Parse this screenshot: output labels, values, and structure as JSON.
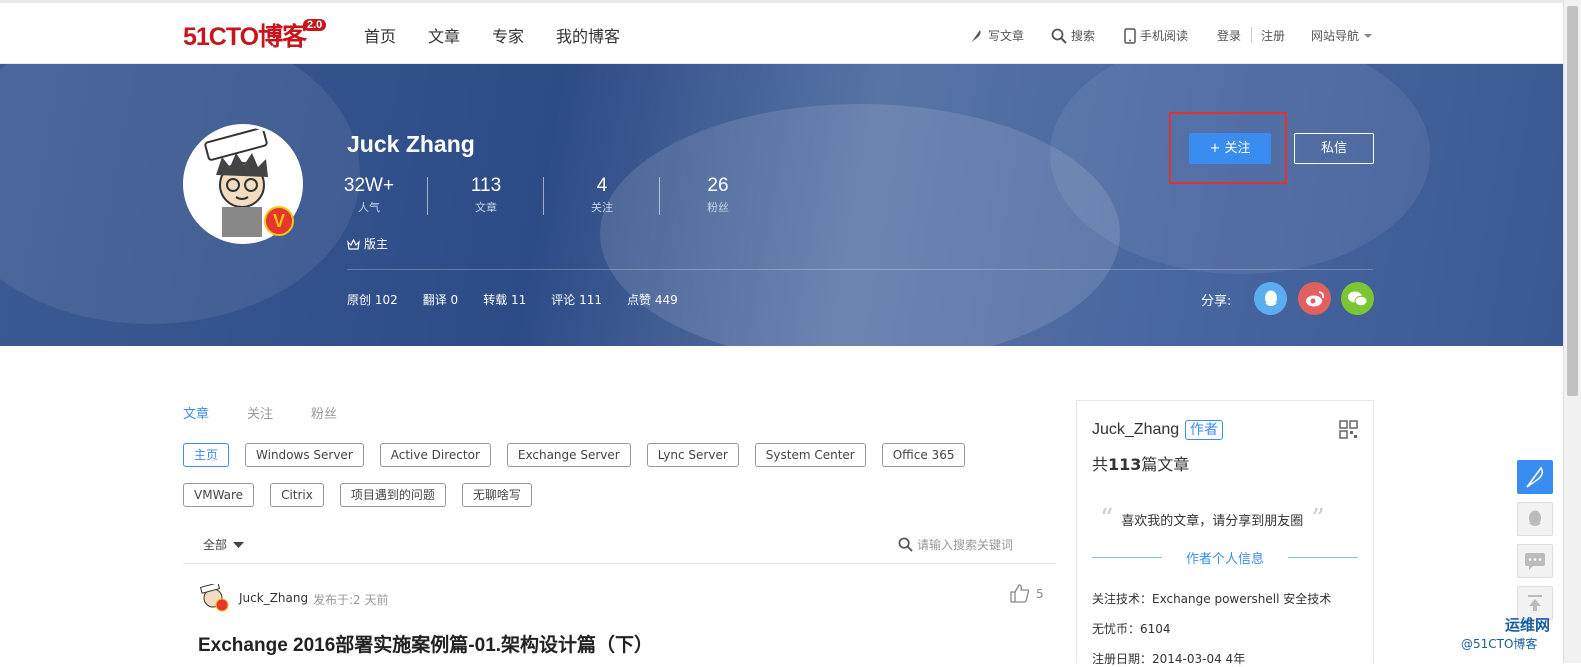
{
  "header": {
    "logo": "51CTO博客",
    "logo_version": "2.0",
    "nav": [
      "首页",
      "文章",
      "专家",
      "我的博客"
    ],
    "write": "写文章",
    "search": "搜索",
    "mobile": "手机阅读",
    "login": "登录",
    "register": "注册",
    "site_nav": "网站导航"
  },
  "profile": {
    "name": "Juck Zhang",
    "stats": [
      {
        "num": "32W+",
        "label": "人气"
      },
      {
        "num": "113",
        "label": "文章"
      },
      {
        "num": "4",
        "label": "关注"
      },
      {
        "num": "26",
        "label": "粉丝"
      }
    ],
    "badge": "版主",
    "counts": [
      "原创 102",
      "翻译 0",
      "转载 11",
      "评论 111",
      "点赞 449"
    ],
    "share_label": "分享:",
    "follow": "关注",
    "message": "私信"
  },
  "content": {
    "tabs": [
      "文章",
      "关注",
      "粉丝"
    ],
    "tags": [
      "主页",
      "Windows Server",
      "Active Director",
      "Exchange Server",
      "Lync Server",
      "System Center",
      "Office 365",
      "VMWare",
      "Citrix",
      "项目遇到的问题",
      "无聊啥写"
    ],
    "filter": "全部",
    "search_placeholder": "请输入搜索关键词",
    "post": {
      "author": "Juck_Zhang",
      "time": "发布于:2 天前",
      "likes": "5",
      "title": "Exchange 2016部署实施案例篇-01.架构设计篇（下）"
    }
  },
  "sidebar": {
    "name": "Juck_Zhang",
    "role": "作者",
    "count_prefix": "共",
    "count": "113",
    "count_suffix": "篇文章",
    "quote": "喜欢我的文章，请分享到朋友圈",
    "info_title": "作者个人信息",
    "tech": "关注技术：Exchange powershell 安全技术",
    "coins": "无忧币：6104",
    "date": "注册日期：2014-03-04 4年"
  },
  "watermark": {
    "brand": "运维网",
    "sub": "@51CTO博客"
  },
  "colors": {
    "accent": "#3a8df0",
    "brand": "#c4161c",
    "highlight": "#e03232"
  }
}
